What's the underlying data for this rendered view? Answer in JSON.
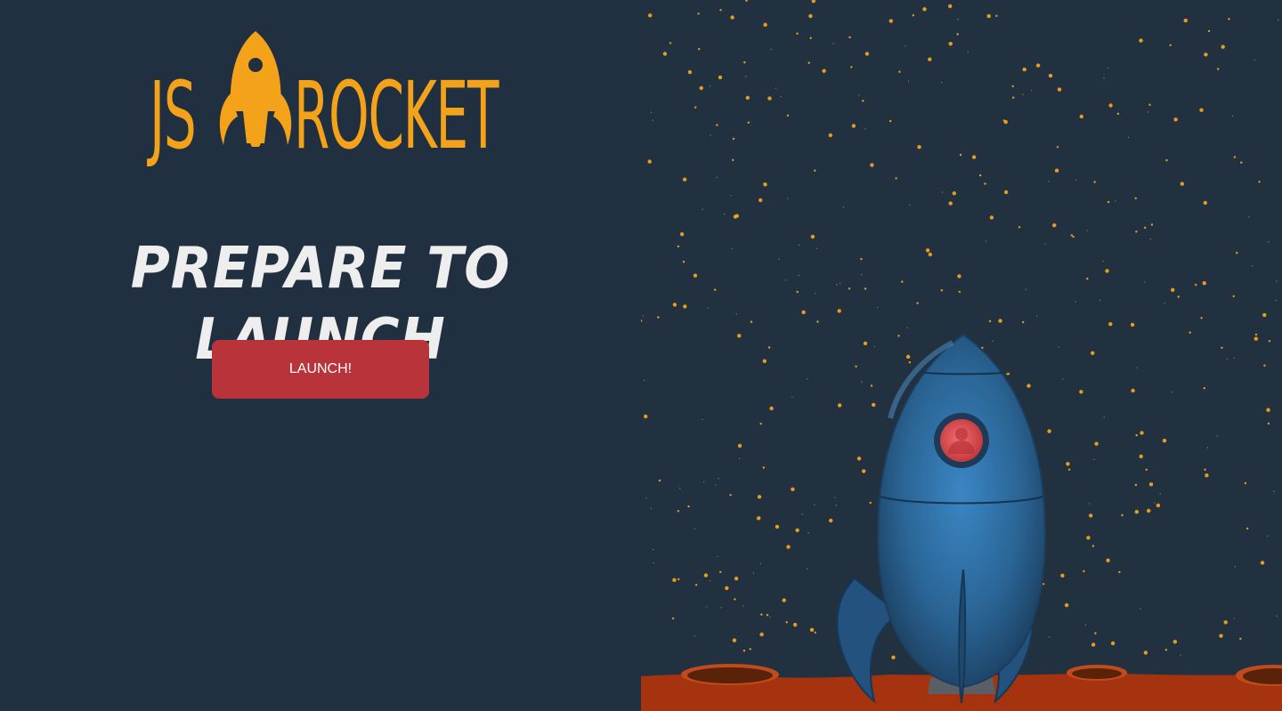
{
  "logo": {
    "left_text": "JS",
    "right_text": "ROCKET",
    "icon": "rocket-icon",
    "color": "#f3a21a"
  },
  "main": {
    "headline": "PREPARE TO LAUNCH",
    "launch_button_label": "LAUNCH!"
  },
  "colors": {
    "background": "#213040",
    "button": "#b9333a",
    "star": "#f3a21a",
    "ground": "#a6330f",
    "rocket_body": "#2e6fa6"
  },
  "scene": {
    "illustration": "rocket-on-planet",
    "icons": [
      "star-icon",
      "crater-icon",
      "porthole-icon"
    ]
  }
}
